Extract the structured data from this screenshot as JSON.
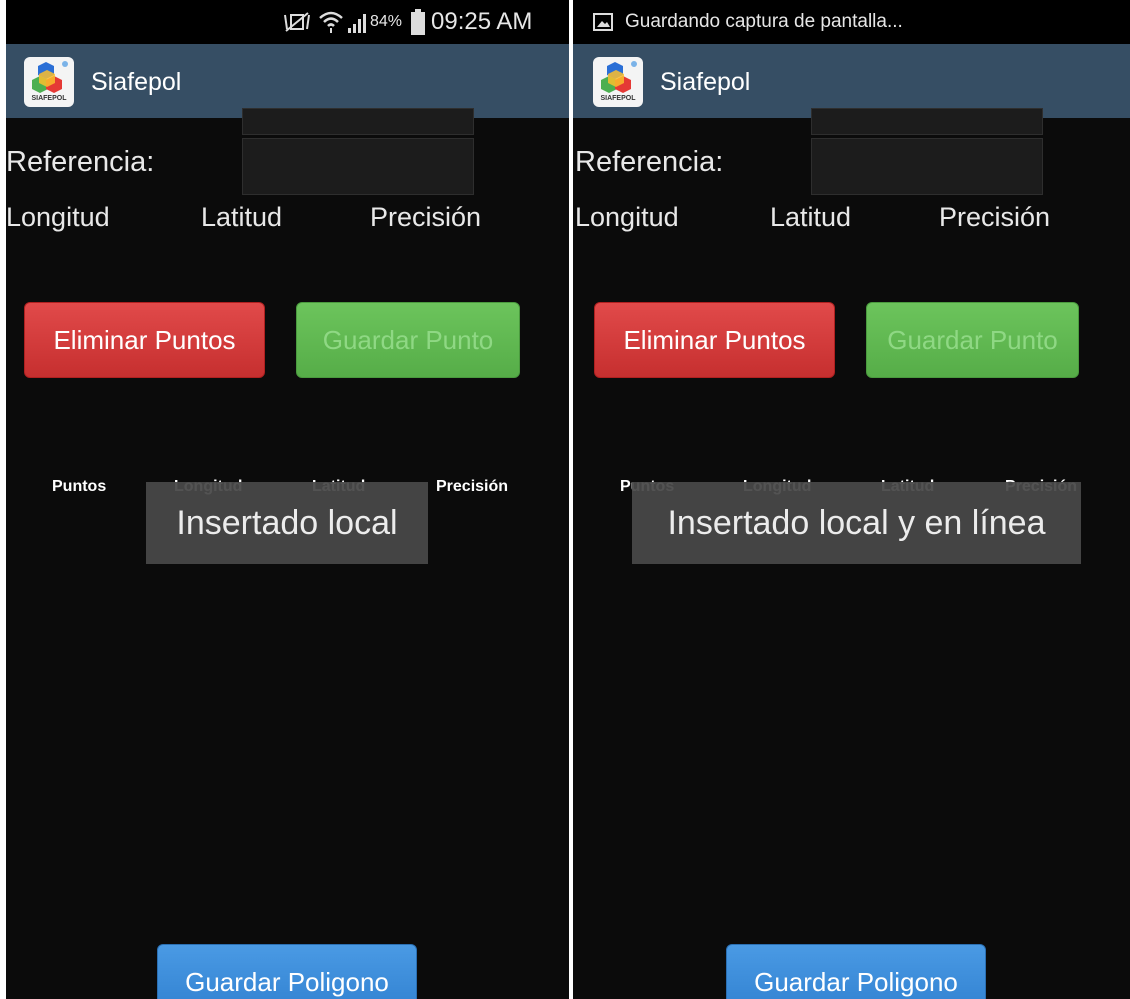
{
  "left": {
    "status": {
      "battery": "84%",
      "time": "09:25 AM"
    },
    "app_title": "Siafepol",
    "logo_caption": "SIAFEPOL",
    "labels": {
      "referencia": "Referencia:",
      "longitud": "Longitud",
      "latitud": "Latitud",
      "precision": "Precisión"
    },
    "buttons": {
      "eliminar": "Eliminar Puntos",
      "guardar_punto": "Guardar Punto",
      "guardar_poligono": "Guardar Poligono"
    },
    "table_headers": [
      "Puntos",
      "Longitud",
      "Latitud",
      "Precisión"
    ],
    "toast": "Insertado local"
  },
  "right": {
    "status": {
      "notification": "Guardando captura de pantalla..."
    },
    "app_title": "Siafepol",
    "logo_caption": "SIAFEPOL",
    "labels": {
      "referencia": "Referencia:",
      "longitud": "Longitud",
      "latitud": "Latitud",
      "precision": "Precisión"
    },
    "buttons": {
      "eliminar": "Eliminar Puntos",
      "guardar_punto": "Guardar Punto",
      "guardar_poligono": "Guardar Poligono"
    },
    "table_headers": [
      "Puntos",
      "Longitud",
      "Latitud",
      "Precisión"
    ],
    "toast": "Insertado local y en línea"
  },
  "icons": [
    "vibrate-mute-icon",
    "wifi-icon",
    "signal-icon",
    "battery-icon",
    "screenshot-image-icon",
    "app-logo-icon"
  ],
  "colors": {
    "actionbar": "#364e64",
    "btn_red": "#d63c3c",
    "btn_green": "#5fb851",
    "btn_blue": "#3a8ad9",
    "background": "#0b0b0b"
  }
}
